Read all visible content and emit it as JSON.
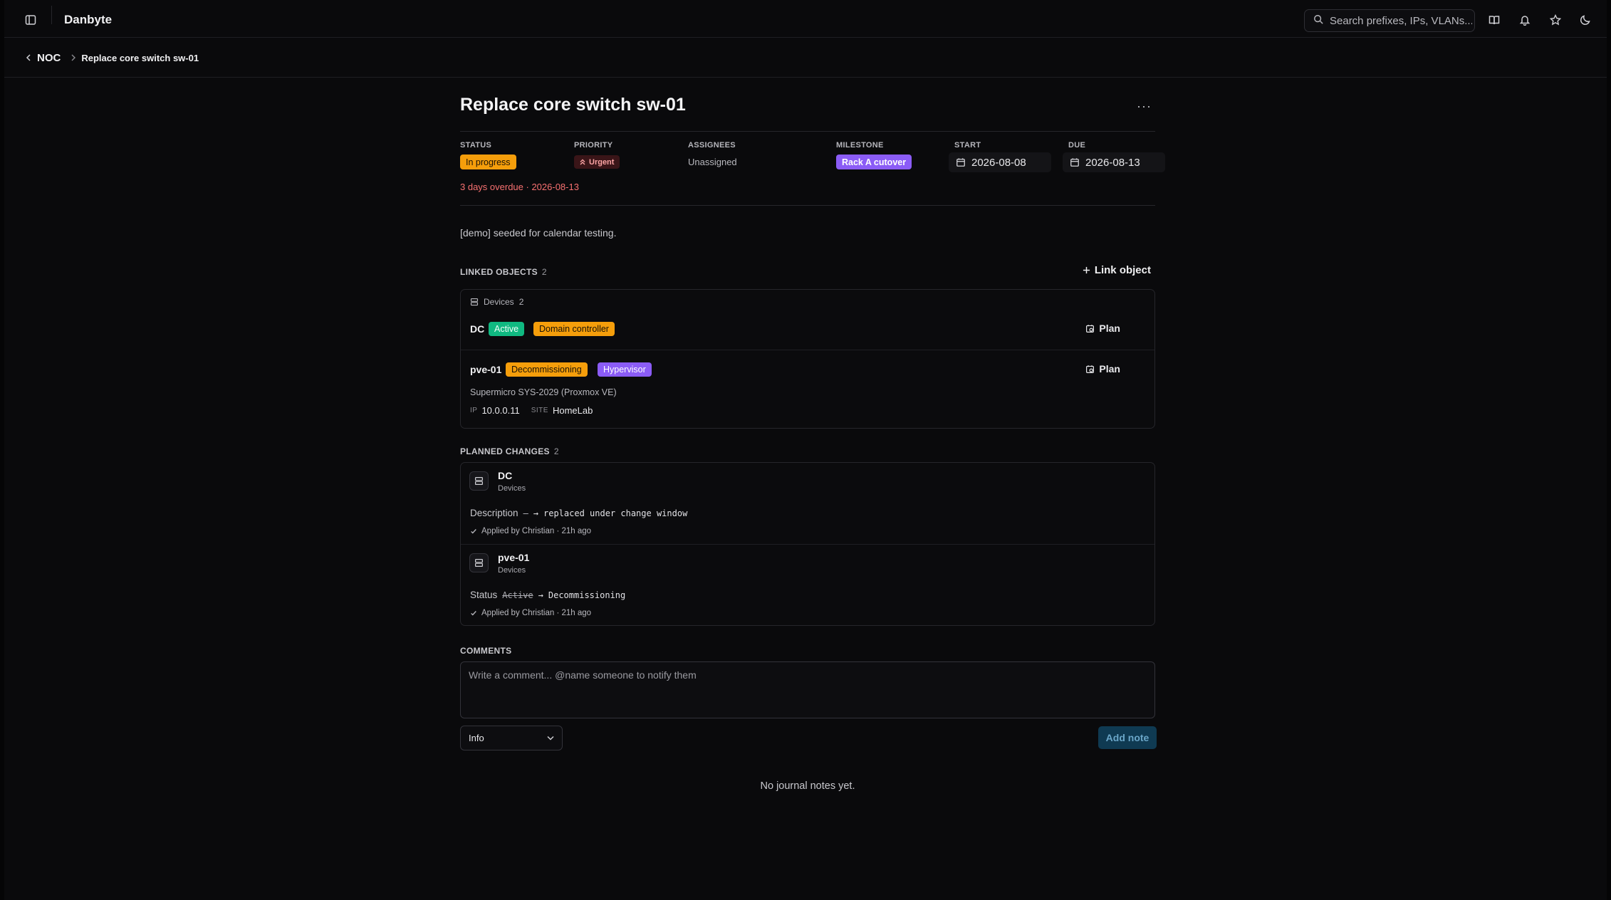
{
  "app": {
    "title": "Danbyte"
  },
  "search": {
    "placeholder": "Search prefixes, IPs, VLANs..."
  },
  "topbar_icons": [
    "sidebar-toggle-icon",
    "book-icon",
    "bell-icon",
    "star-icon",
    "moon-icon"
  ],
  "breadcrumb": {
    "parent": "NOC",
    "current": "Replace core switch sw-01"
  },
  "issue": {
    "title": "Replace core switch sw-01",
    "more": "···",
    "status_label": "STATUS",
    "status": "In progress",
    "priority_label": "PRIORITY",
    "priority": "Urgent",
    "assignees_label": "ASSIGNEES",
    "assignees": "Unassigned",
    "milestone_label": "MILESTONE",
    "milestone": "Rack A cutover",
    "start_label": "START",
    "start": "2026-08-08",
    "due_label": "DUE",
    "due": "2026-08-13",
    "overdue": "3 days overdue · 2026-08-13",
    "description": "[demo] seeded for calendar testing."
  },
  "linked": {
    "label": "LINKED OBJECTS",
    "count": "2",
    "link_button": "Link object",
    "group_label": "Devices",
    "group_count": "2",
    "devices": [
      {
        "name": "DC",
        "tags": [
          "Active",
          "Domain controller"
        ],
        "plan": "Plan"
      },
      {
        "name": "pve-01",
        "tags": [
          "Decommissioning",
          "Hypervisor"
        ],
        "plan": "Plan",
        "subtitle": "Supermicro SYS-2029 (Proxmox VE)",
        "ip_label": "IP",
        "ip": "10.0.0.11",
        "site_label": "SITE",
        "site": "HomeLab"
      }
    ]
  },
  "planned": {
    "label": "PLANNED CHANGES",
    "count": "2",
    "changes": [
      {
        "name": "DC",
        "type": "Devices",
        "field": "Description",
        "old": "—",
        "arrow": "→",
        "new": "replaced under change window",
        "applied": "Applied by Christian · 21h ago"
      },
      {
        "name": "pve-01",
        "type": "Devices",
        "field": "Status",
        "old": "Active",
        "arrow": "→",
        "new": "Decommissioning",
        "applied": "Applied by Christian · 21h ago"
      }
    ]
  },
  "comments": {
    "label": "COMMENTS",
    "placeholder": "Write a comment... @name someone to notify them",
    "level": "Info",
    "add_button": "Add note",
    "empty": "No journal notes yet."
  },
  "colors": {
    "status": "#f59e0b",
    "milestone": "#8b5cf6",
    "active": "#10b981",
    "domain_controller": "#f59e0b",
    "decommissioning": "#f59e0b",
    "hypervisor": "#8b5cf6",
    "overdue": "#f87171",
    "urgent": "#fda4a4"
  }
}
